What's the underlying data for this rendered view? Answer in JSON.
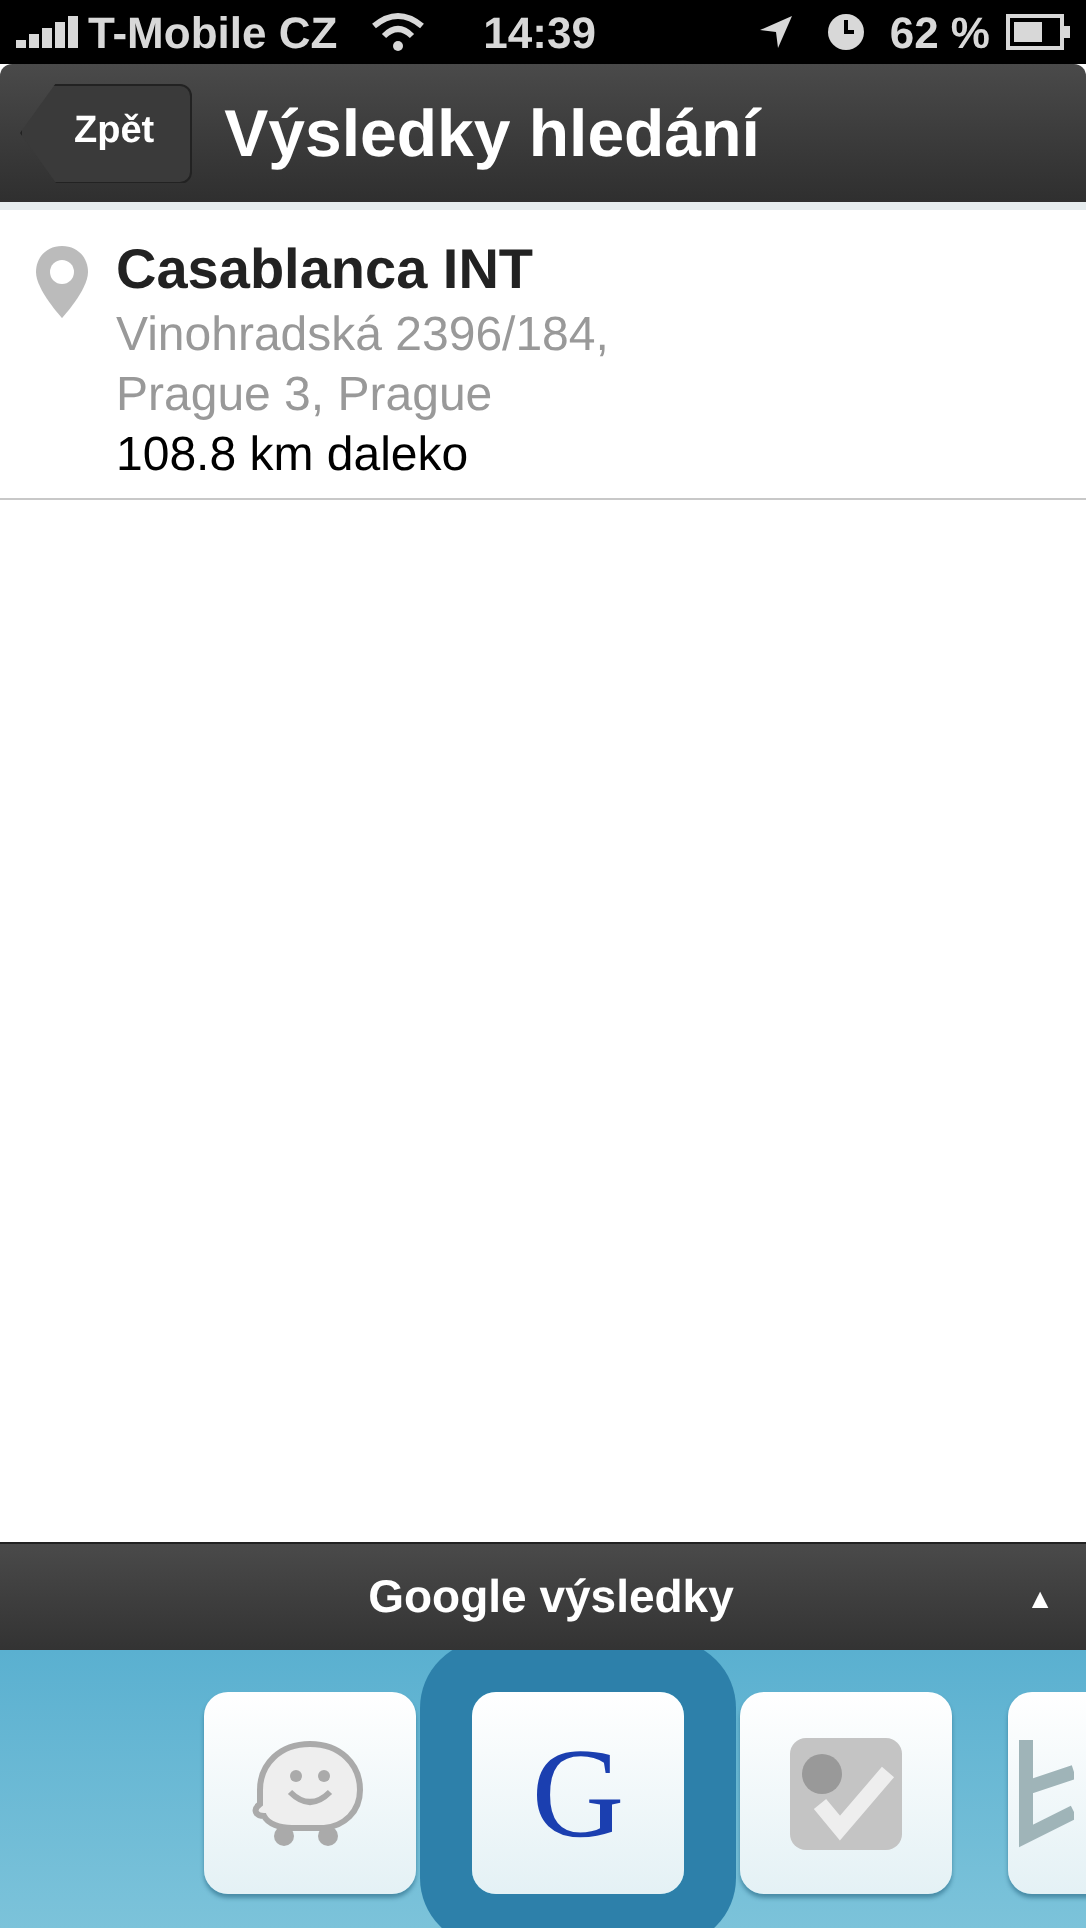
{
  "status_bar": {
    "carrier": "T-Mobile CZ",
    "time": "14:39",
    "battery": "62 %"
  },
  "nav_bar": {
    "back": "Zpět",
    "title": "Výsledky hledání"
  },
  "results": [
    {
      "name": "Casablanca INT",
      "address_lines": [
        "Vinohradská 2396/184,",
        "Prague 3, Prague"
      ],
      "distance": "108.8 km daleko"
    }
  ],
  "source_bar": {
    "title": "Google výsledky",
    "toggle": "▲"
  },
  "providers": [
    {
      "kind": "waze",
      "selected": false
    },
    {
      "kind": "google",
      "label": "G",
      "selected": true
    },
    {
      "kind": "foursquare",
      "selected": false
    },
    {
      "kind": "bing",
      "selected": false
    }
  ]
}
